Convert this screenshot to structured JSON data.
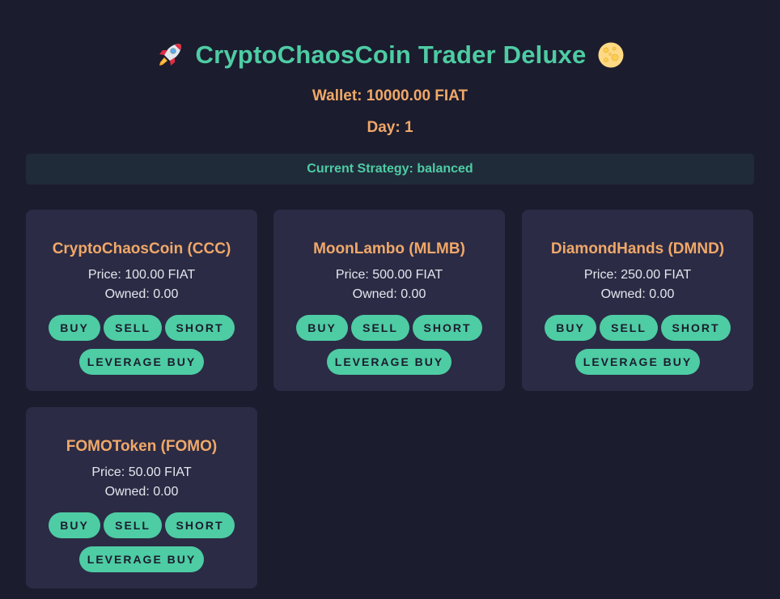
{
  "header": {
    "title": "CryptoChaosCoin Trader Deluxe",
    "left_icon": "rocket-icon",
    "right_icon": "moon-icon"
  },
  "wallet_text": "Wallet: 10000.00 FIAT",
  "day_text": "Day: 1",
  "strategy_text": "Current Strategy: balanced",
  "coins": [
    {
      "name": "CryptoChaosCoin (CCC)",
      "price": "Price: 100.00 FIAT",
      "owned": "Owned: 0.00"
    },
    {
      "name": "MoonLambo (MLMB)",
      "price": "Price: 500.00 FIAT",
      "owned": "Owned: 0.00"
    },
    {
      "name": "DiamondHands (DMND)",
      "price": "Price: 250.00 FIAT",
      "owned": "Owned: 0.00"
    },
    {
      "name": "FOMOToken (FOMO)",
      "price": "Price: 50.00 FIAT",
      "owned": "Owned: 0.00"
    }
  ],
  "buttons": {
    "buy": "BUY",
    "sell": "SELL",
    "short": "SHORT",
    "leverage_buy": "LEVERAGE BUY"
  },
  "colors": {
    "background": "#1b1c2e",
    "accent": "#4ecca3",
    "highlight": "#f0a868",
    "card": "#2b2b45",
    "strategy_bar": "#202b3a"
  }
}
